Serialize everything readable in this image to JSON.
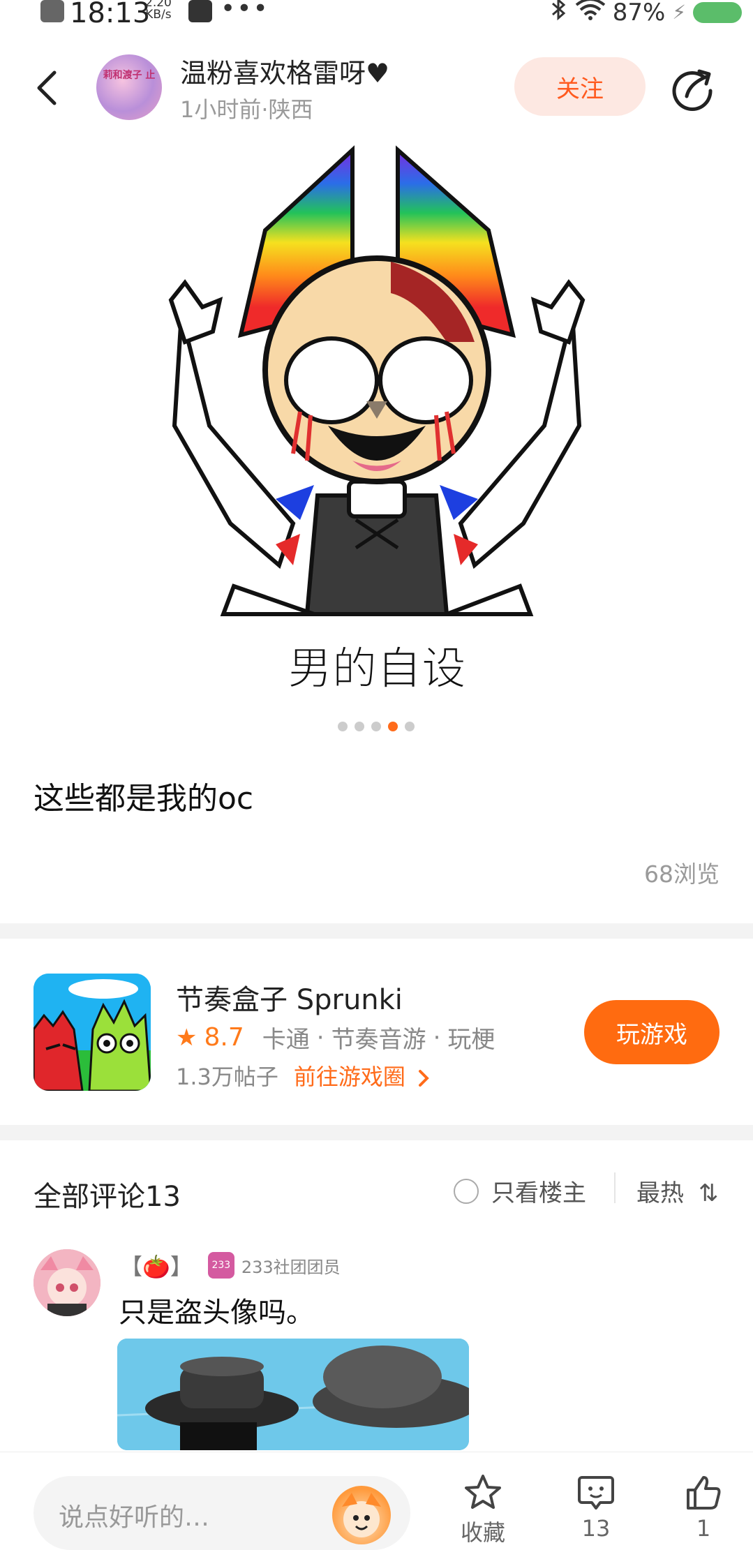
{
  "status_bar": {
    "time": "18:13",
    "net_speed_value": "2.20",
    "net_speed_unit": "KB/s",
    "more": "•••",
    "battery": "87%"
  },
  "header": {
    "username": "温粉喜欢格雷呀♥",
    "meta": "1小时前·陕西",
    "follow_label": "关注",
    "avatar_text": "莉和渡子 止"
  },
  "post": {
    "image_caption": "男的自设",
    "carousel_total": 5,
    "carousel_active_index": 3,
    "text": "这些都是我的oc",
    "views": "68浏览"
  },
  "game": {
    "title": "节奏盒子 Sprunki",
    "rating": "8.7",
    "tags": [
      "卡通",
      "节奏音游",
      "玩梗"
    ],
    "tag_separator": "·",
    "posts": "1.3万帖子",
    "go_label": "前往游戏圈",
    "play_label": "玩游戏"
  },
  "comments": {
    "title": "全部评论13",
    "only_owner": "只看楼主",
    "sort": "最热",
    "items": [
      {
        "name": "【🍅】",
        "badge": "233",
        "role": "233社团团员",
        "text": "只是盗头像吗。"
      }
    ]
  },
  "bottom_bar": {
    "placeholder": "说点好听的…",
    "favorite_label": "收藏",
    "comment_count": "13",
    "like_count": "1"
  },
  "colors": {
    "accent": "#ff6b10",
    "follow_bg": "#fde8e2",
    "follow_text": "#ff5a1f"
  }
}
